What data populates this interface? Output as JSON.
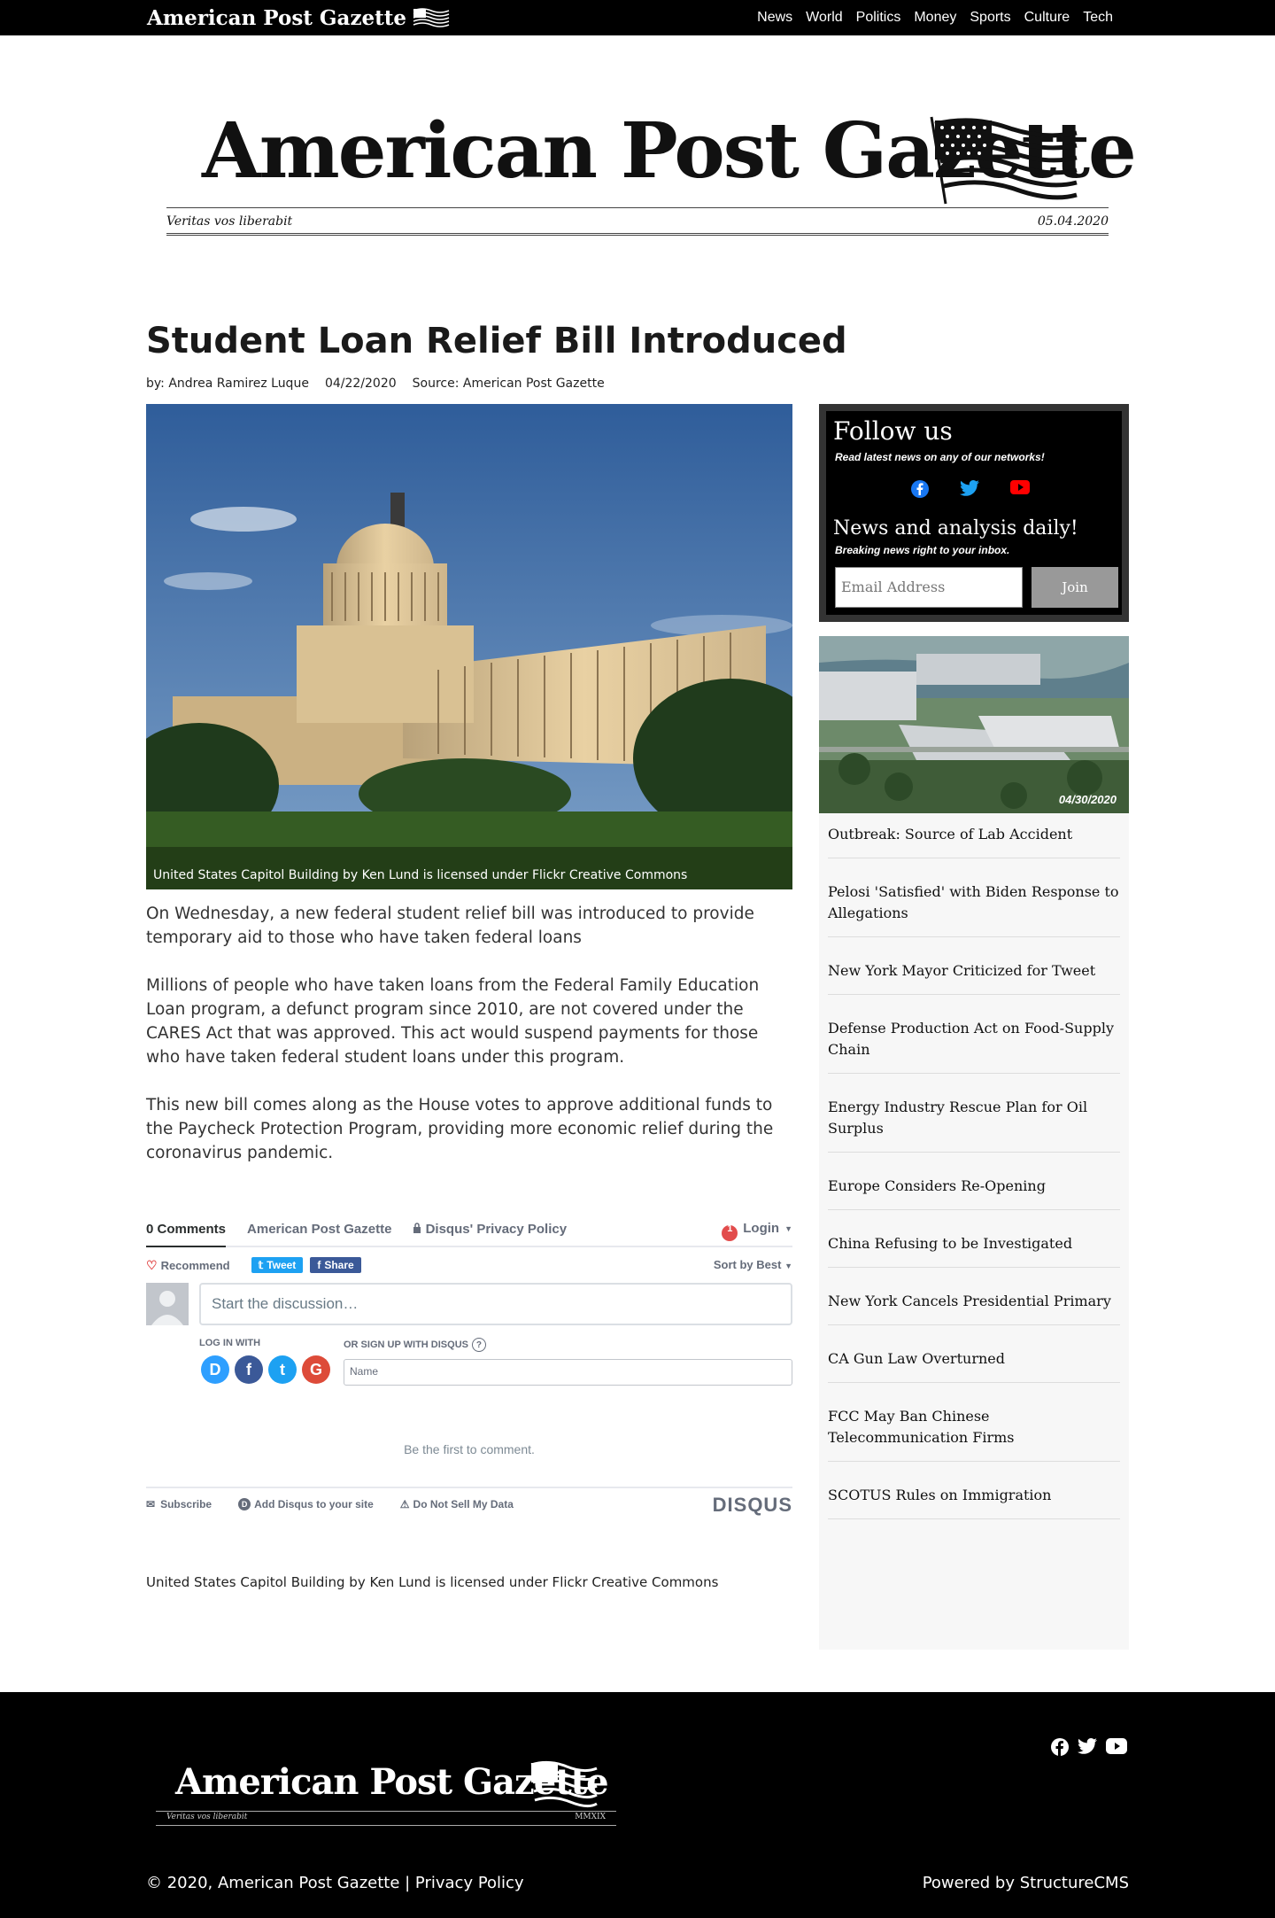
{
  "site": {
    "brand": "American Post Gazette",
    "motto": "Veritas vos liberabit",
    "masthead_date": "05.04.2020",
    "nav": [
      "News",
      "World",
      "Politics",
      "Money",
      "Sports",
      "Culture",
      "Tech"
    ]
  },
  "article": {
    "headline": "Student Loan Relief Bill Introduced",
    "author": "by: Andrea Ramirez Luque",
    "date": "04/22/2020",
    "source": "Source: American Post Gazette",
    "image_caption": "United States Capitol Building by Ken Lund is licensed under Flickr Creative Commons",
    "paragraphs": [
      "On Wednesday, a new federal student relief bill was introduced to provide temporary aid to those who have taken federal loans",
      "Millions of people who have taken loans from the Federal Family Education Loan program, a defunct program since 2010, are not covered under the CARES Act that was approved. This act would suspend payments for those who have taken federal student loans under this program.",
      "This new bill comes along as the House votes to approve additional funds to the Paycheck Protection Program, providing more economic relief during the coronavirus pandemic."
    ],
    "credit": "United States Capitol Building by Ken Lund is licensed under Flickr Creative Commons"
  },
  "comments": {
    "tab_comments": "0 Comments",
    "tab_site": "American Post Gazette",
    "tab_privacy": "Disqus' Privacy Policy",
    "notif_count": "1",
    "login": "Login",
    "recommend": "Recommend",
    "tweet": "Tweet",
    "share": "Share",
    "sort": "Sort by Best",
    "placeholder": "Start the discussion…",
    "log_in_with": "LOG IN WITH",
    "sign_up": "OR SIGN UP WITH DISQUS",
    "name_placeholder": "Name",
    "empty": "Be the first to comment.",
    "subscribe": "Subscribe",
    "add_disqus": "Add Disqus to your site",
    "do_not_sell": "Do Not Sell My Data",
    "brand": "DISQUS"
  },
  "sidebar": {
    "follow_title": "Follow us",
    "follow_sub": "Read latest news on any of our networks!",
    "news_title": "News and analysis daily!",
    "news_sub": "Breaking news right to your inbox.",
    "email_placeholder": "Email Address",
    "join": "Join",
    "thumb_date": "04/30/2020",
    "stories": [
      "Outbreak: Source of Lab Accident",
      "Pelosi 'Satisfied' with Biden Response to Allegations",
      "New York Mayor Criticized for Tweet",
      "Defense Production Act on Food-Supply Chain",
      "Energy Industry Rescue Plan for Oil Surplus",
      "Europe Considers Re-Opening",
      "China Refusing to be Investigated",
      "New York Cancels Presidential Primary",
      "CA Gun Law Overturned",
      "FCC May Ban Chinese Telecommunication Firms",
      "SCOTUS Rules on Immigration"
    ]
  },
  "footer": {
    "motto": "Veritas vos liberabit",
    "roman": "MMXIX",
    "copyright": "© 2020, American Post Gazette | Privacy Policy",
    "powered": "Powered by StructureCMS"
  },
  "colors": {
    "facebook": "#1877f2",
    "twitter": "#1da1f2",
    "youtube": "#ff0000",
    "disqus_blue": "#2e9fff",
    "google_red": "#dd4b39"
  }
}
